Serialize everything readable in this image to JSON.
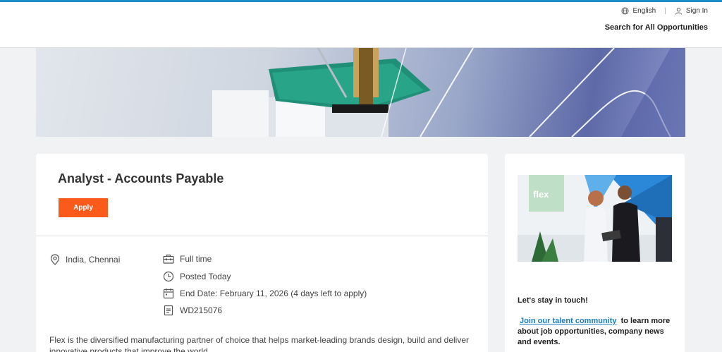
{
  "header": {
    "language_label": "English",
    "signin_label": "Sign In",
    "search_all_label": "Search for All Opportunities"
  },
  "job": {
    "title": "Analyst - Accounts Payable",
    "apply_label": "Apply",
    "location": "India, Chennai",
    "employment_type": "Full time",
    "posted": "Posted Today",
    "end_date": "End Date: February 11, 2026 (4 days left to apply)",
    "req_id": "WD215076",
    "description": "Flex is the diversified manufacturing partner of choice that helps market-leading brands design, build and deliver innovative products that improve the world."
  },
  "sidebar": {
    "image_logo_text": "flex",
    "stay_in_touch": "Let's stay in touch!",
    "talent_link": "Join our talent community",
    "talent_rest": "to learn more about job opportunities, company news and events."
  },
  "colors": {
    "accent_top": "#1c8dc6",
    "apply_orange": "#fa5b1b",
    "link_blue": "#1a7dbd"
  }
}
